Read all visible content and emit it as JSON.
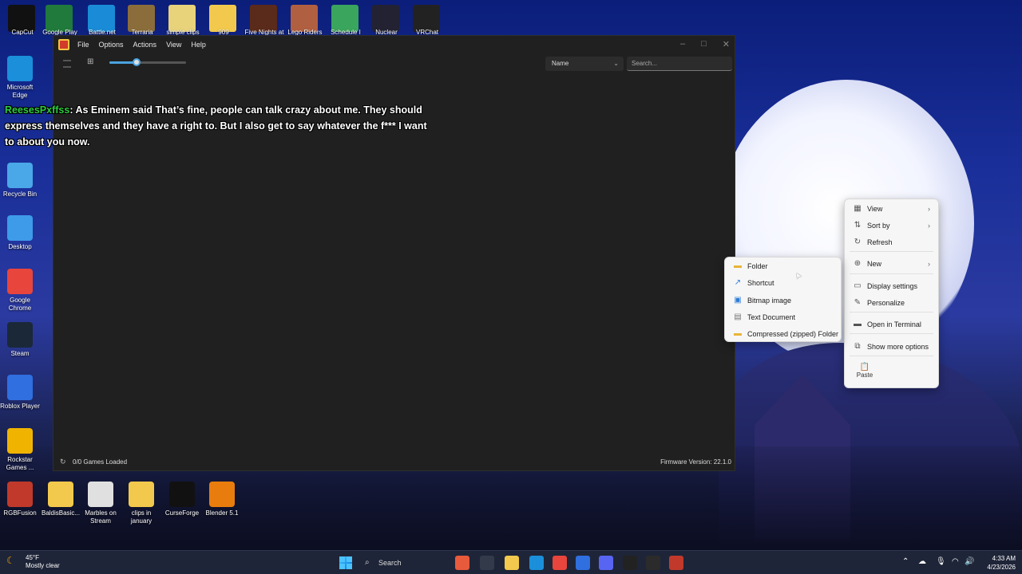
{
  "desktop": {
    "top_icons": [
      {
        "label": "CapCut",
        "color": "#111111"
      },
      {
        "label": "Google Play Games",
        "color": "#1f7a3c"
      },
      {
        "label": "Battle.net",
        "color": "#1a8bd6"
      },
      {
        "label": "Terraria",
        "color": "#8a6d3b"
      },
      {
        "label": "simple clips",
        "color": "#e8d27a"
      },
      {
        "label": "909",
        "color": "#f2c94c"
      },
      {
        "label": "Five Nights at Freddy's",
        "color": "#5a2a1a"
      },
      {
        "label": "Lego Riders",
        "color": "#b06040"
      },
      {
        "label": "Schedule I",
        "color": "#3aa55c"
      },
      {
        "label": "Nuclear",
        "color": "#222233"
      },
      {
        "label": "VRChat",
        "color": "#222222"
      }
    ],
    "left_icons": [
      {
        "label": "Microsoft Edge",
        "color": "#1b8fd9"
      },
      {
        "label": "Recycle Bin",
        "color": "#4aa7e8"
      },
      {
        "label": "Desktop",
        "color": "#3d9be9"
      },
      {
        "label": "Google Chrome",
        "color": "#e8453c"
      },
      {
        "label": "Steam",
        "color": "#1b2838"
      },
      {
        "label": "Roblox Player",
        "color": "#2f6fe0"
      },
      {
        "label": "Rockstar Games ...",
        "color": "#f0b400"
      },
      {
        "label": "RGBFusion",
        "color": "#c0392b"
      }
    ],
    "bottom_icons": [
      {
        "label": "BaldisBasic...",
        "color": "#f2c94c"
      },
      {
        "label": "Marbles on Stream",
        "color": "#e0e0e0"
      },
      {
        "label": "clips in january",
        "color": "#f2c94c"
      },
      {
        "label": "CurseForge",
        "color": "#111111"
      },
      {
        "label": "Blender 5.1",
        "color": "#e87d0d"
      }
    ]
  },
  "app": {
    "menu": [
      "File",
      "Options",
      "Actions",
      "View",
      "Help"
    ],
    "slider_value": 0.35,
    "sort_label": "Name",
    "search_placeholder": "Search...",
    "games_loaded": "0/0 Games Loaded",
    "firmware": "Firmware Version: 22.1.0"
  },
  "chat": {
    "username": "ReesesPxffss",
    "message": ": As Eminem said That’s fine, people can talk crazy about me. They should express themselves and they have a right to. But I also get to say whatever the f*** I want to about you now."
  },
  "context_menu": {
    "items": [
      {
        "label": "View",
        "icon": "view-icon",
        "glyph": "▦",
        "arrow": true
      },
      {
        "label": "Sort by",
        "icon": "sort-icon",
        "glyph": "⇅",
        "arrow": true
      },
      {
        "label": "Refresh",
        "icon": "refresh-icon",
        "glyph": "↻",
        "arrow": false
      },
      {
        "label": "New",
        "icon": "new-icon",
        "glyph": "⊕",
        "arrow": true
      },
      {
        "label": "Display settings",
        "icon": "display-icon",
        "glyph": "▭",
        "arrow": false
      },
      {
        "label": "Personalize",
        "icon": "brush-icon",
        "glyph": "✎",
        "arrow": false
      },
      {
        "label": "Open in Terminal",
        "icon": "terminal-icon",
        "glyph": "▬",
        "arrow": false
      },
      {
        "label": "Show more options",
        "icon": "more-icon",
        "glyph": "⧉",
        "arrow": false
      }
    ],
    "paste_label": "Paste"
  },
  "new_submenu": {
    "items": [
      {
        "label": "Folder",
        "icon": "folder-icon",
        "glyph": "▬",
        "color": "#e8b53a"
      },
      {
        "label": "Shortcut",
        "icon": "shortcut-icon",
        "glyph": "↗",
        "color": "#2b7bd6"
      },
      {
        "label": "Bitmap image",
        "icon": "bitmap-icon",
        "glyph": "▣",
        "color": "#2b7bd6"
      },
      {
        "label": "Text Document",
        "icon": "text-doc-icon",
        "glyph": "▤",
        "color": "#777777"
      },
      {
        "label": "Compressed (zipped) Folder",
        "icon": "zip-folder-icon",
        "glyph": "▬",
        "color": "#e8b53a"
      }
    ]
  },
  "taskbar": {
    "weather_temp": "45°F",
    "weather_desc": "Mostly clear",
    "search_label": "Search",
    "time": "4:33 AM",
    "date": "4/23/2026",
    "apps": [
      "#e85a3c",
      "#333a4a",
      "#f2c94c",
      "#1b8fd9",
      "#e8453c",
      "#2f6fe0",
      "#5865f2",
      "#222222",
      "#2b2b2b",
      "#c0392b"
    ]
  }
}
